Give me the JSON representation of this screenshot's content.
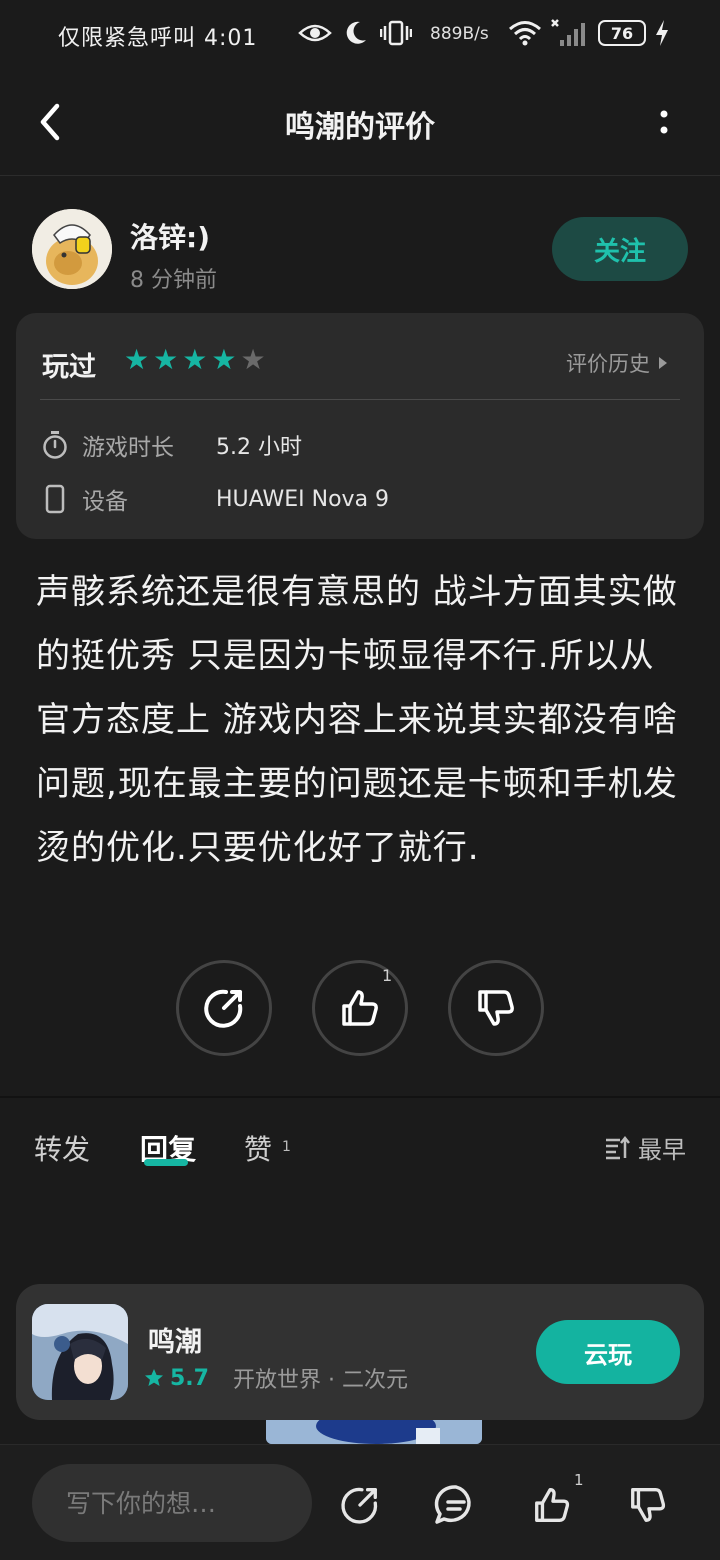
{
  "status_bar": {
    "carrier_text": "仅限紧急呼叫",
    "time": "4:01",
    "net_speed": "889B/s",
    "battery": "76"
  },
  "header": {
    "title": "鸣潮的评价"
  },
  "review": {
    "user_name": "洛锌:)",
    "posted_time": "8 分钟前",
    "follow_label": "关注",
    "played_label": "玩过",
    "rating": 4,
    "max_rating": 5,
    "history_label": "评价历史",
    "playtime_label": "游戏时长",
    "playtime_value": "5.2 小时",
    "device_label": "设备",
    "device_value": "HUAWEI Nova 9",
    "text": "声骸系统还是很有意思的 战斗方面其实做的挺优秀 只是因为卡顿显得不行.所以从官方态度上 游戏内容上来说其实都没有啥问题,现在最主要的问题还是卡顿和手机发烫的优化.只要优化好了就行.",
    "like_count": "1"
  },
  "tabs": {
    "items": [
      {
        "label": "转发"
      },
      {
        "label": "回复"
      },
      {
        "label": "赞"
      }
    ],
    "active": "回复",
    "like_tab_count": "1",
    "sort_label": "最早"
  },
  "game_card": {
    "name": "鸣潮",
    "rating": "5.7",
    "tags": "开放世界 · 二次元",
    "cloud_play_label": "云玩"
  },
  "bottom_bar": {
    "comment_placeholder": "写下你的想…",
    "like_count": "1"
  },
  "colors": {
    "accent": "#16b6a3",
    "star_on": "#16b6a3",
    "star_off": "#6a6a6a",
    "background": "#1b1b1b",
    "card": "#2b2b2b"
  }
}
